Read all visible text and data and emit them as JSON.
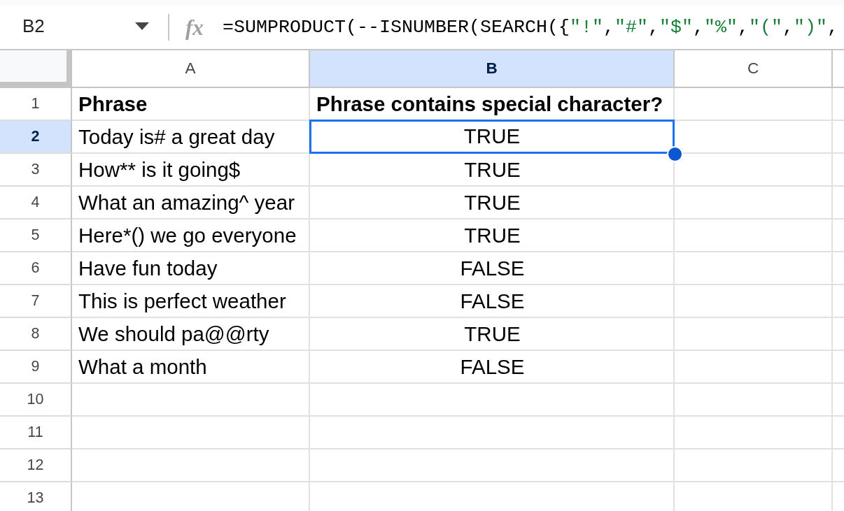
{
  "formula_bar": {
    "cell_reference": "B2",
    "function_icon": "fx",
    "formula": [
      {
        "kind": "code",
        "text": "=SUMPRODUCT(--ISNUMBER(SEARCH({"
      },
      {
        "kind": "string",
        "text": "\"!\""
      },
      {
        "kind": "code",
        "text": ","
      },
      {
        "kind": "string",
        "text": "\"#\""
      },
      {
        "kind": "code",
        "text": ","
      },
      {
        "kind": "string",
        "text": "\"$\""
      },
      {
        "kind": "code",
        "text": ","
      },
      {
        "kind": "string",
        "text": "\"%\""
      },
      {
        "kind": "code",
        "text": ","
      },
      {
        "kind": "string",
        "text": "\"(\""
      },
      {
        "kind": "code",
        "text": ","
      },
      {
        "kind": "string",
        "text": "\")\""
      },
      {
        "kind": "code",
        "text": ","
      }
    ]
  },
  "columns": [
    {
      "label": "A",
      "selected": false
    },
    {
      "label": "B",
      "selected": true
    },
    {
      "label": "C",
      "selected": false
    }
  ],
  "rows": [
    {
      "number": "1",
      "selected": false,
      "kind": "header",
      "cells": [
        {
          "text": "Phrase",
          "selected": false
        },
        {
          "text": "Phrase contains special character?",
          "selected": false
        }
      ]
    },
    {
      "number": "2",
      "selected": true,
      "kind": "data",
      "cells": [
        {
          "text": "Today is# a great day",
          "selected": false
        },
        {
          "text": "TRUE",
          "selected": true
        }
      ]
    },
    {
      "number": "3",
      "selected": false,
      "kind": "data",
      "cells": [
        {
          "text": "How** is it going$",
          "selected": false
        },
        {
          "text": "TRUE",
          "selected": false
        }
      ]
    },
    {
      "number": "4",
      "selected": false,
      "kind": "data",
      "cells": [
        {
          "text": "What an amazing^ year",
          "selected": false
        },
        {
          "text": "TRUE",
          "selected": false
        }
      ]
    },
    {
      "number": "5",
      "selected": false,
      "kind": "data",
      "cells": [
        {
          "text": "Here*() we go everyone",
          "selected": false
        },
        {
          "text": "TRUE",
          "selected": false
        }
      ]
    },
    {
      "number": "6",
      "selected": false,
      "kind": "data",
      "cells": [
        {
          "text": "Have fun today",
          "selected": false
        },
        {
          "text": "FALSE",
          "selected": false
        }
      ]
    },
    {
      "number": "7",
      "selected": false,
      "kind": "data",
      "cells": [
        {
          "text": "This is perfect weather",
          "selected": false
        },
        {
          "text": "FALSE",
          "selected": false
        }
      ]
    },
    {
      "number": "8",
      "selected": false,
      "kind": "data",
      "cells": [
        {
          "text": "We should pa@@rty",
          "selected": false
        },
        {
          "text": "TRUE",
          "selected": false
        }
      ]
    },
    {
      "number": "9",
      "selected": false,
      "kind": "data",
      "cells": [
        {
          "text": "What a month",
          "selected": false
        },
        {
          "text": "FALSE",
          "selected": false
        }
      ]
    },
    {
      "number": "10",
      "selected": false,
      "kind": "data"
    },
    {
      "number": "11",
      "selected": false,
      "kind": "data"
    },
    {
      "number": "12",
      "selected": false,
      "kind": "data"
    },
    {
      "number": "13",
      "selected": false,
      "kind": "data"
    }
  ]
}
